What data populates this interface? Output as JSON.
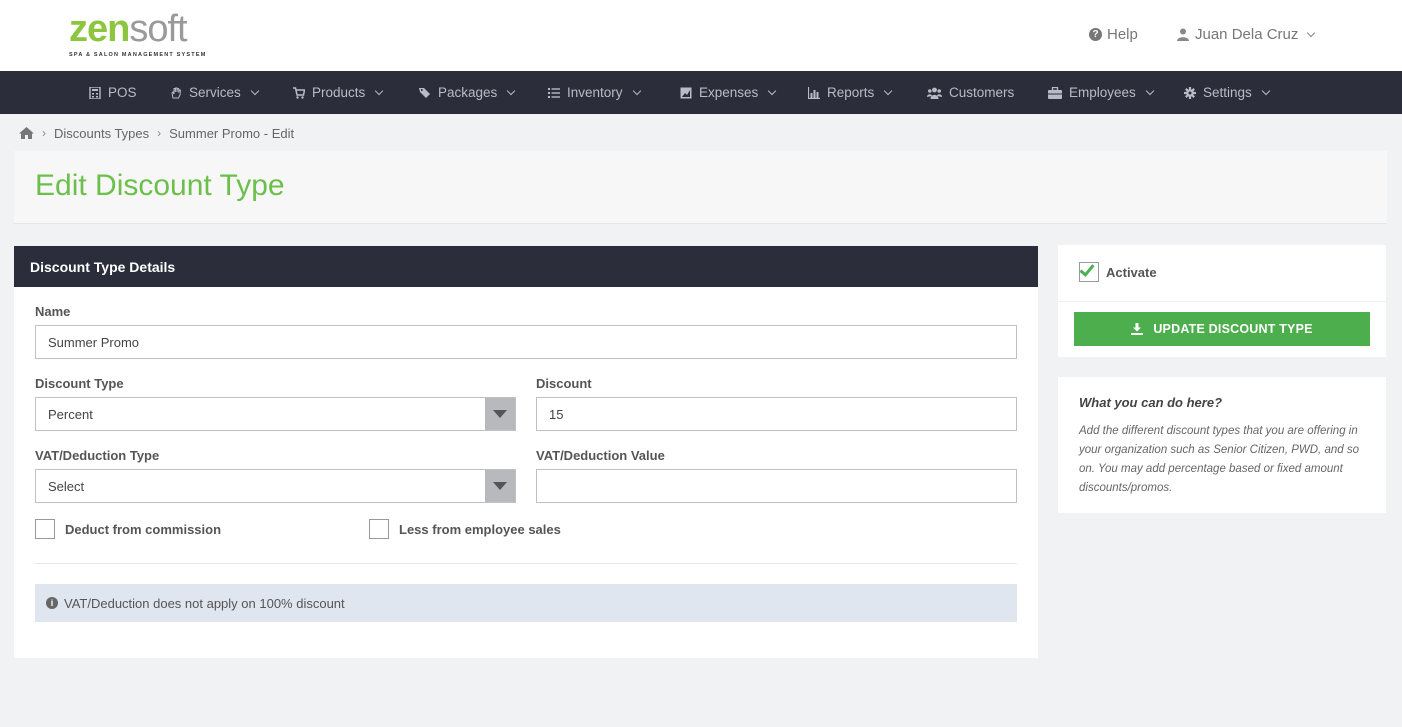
{
  "header": {
    "logo": {
      "primary": "zen",
      "secondary": "soft",
      "tagline": "SPA & SALON MANAGEMENT SYSTEM"
    },
    "help_label": "Help",
    "user_name": "Juan Dela Cruz"
  },
  "nav": {
    "items": [
      {
        "label": "POS",
        "icon": "calculator-icon",
        "has_dropdown": false
      },
      {
        "label": "Services",
        "icon": "hand-icon",
        "has_dropdown": true
      },
      {
        "label": "Products",
        "icon": "cart-icon",
        "has_dropdown": true
      },
      {
        "label": "Packages",
        "icon": "tags-icon",
        "has_dropdown": true
      },
      {
        "label": "Inventory",
        "icon": "list-icon",
        "has_dropdown": true
      },
      {
        "label": "Expenses",
        "icon": "image-icon",
        "has_dropdown": true
      },
      {
        "label": "Reports",
        "icon": "bar-chart-icon",
        "has_dropdown": true
      },
      {
        "label": "Customers",
        "icon": "users-icon",
        "has_dropdown": false
      },
      {
        "label": "Employees",
        "icon": "briefcase-icon",
        "has_dropdown": true
      },
      {
        "label": "Settings",
        "icon": "gear-icon",
        "has_dropdown": true
      }
    ]
  },
  "breadcrumb": {
    "items": [
      "Discounts Types",
      "Summer Promo - Edit"
    ]
  },
  "page": {
    "title": "Edit Discount Type"
  },
  "form": {
    "section_title": "Discount Type Details",
    "name": {
      "label": "Name",
      "value": "Summer Promo"
    },
    "discount_type": {
      "label": "Discount Type",
      "value": "Percent"
    },
    "discount": {
      "label": "Discount",
      "value": "15"
    },
    "vat_type": {
      "label": "VAT/Deduction Type",
      "value": "Select"
    },
    "vat_value": {
      "label": "VAT/Deduction Value",
      "value": ""
    },
    "deduct_commission": {
      "label": "Deduct from commission",
      "checked": false
    },
    "less_employee_sales": {
      "label": "Less from employee sales",
      "checked": false
    },
    "note": "VAT/Deduction does not apply on 100% discount"
  },
  "side": {
    "activate": {
      "label": "Activate",
      "checked": true
    },
    "update_button": "UPDATE DISCOUNT TYPE",
    "help": {
      "title": "What you can do here?",
      "text": "Add the different discount types that you are offering in your organization such as Senior Citizen, PWD, and so on. You may add percentage based or fixed amount discounts/promos."
    }
  },
  "colors": {
    "brand_green": "#8cc63f",
    "title_green": "#6cbf4a",
    "button_green": "#4cae4c",
    "navbar": "#2b2d3a",
    "page_bg": "#f1f2f4",
    "note_bg": "#dfe6ef"
  }
}
